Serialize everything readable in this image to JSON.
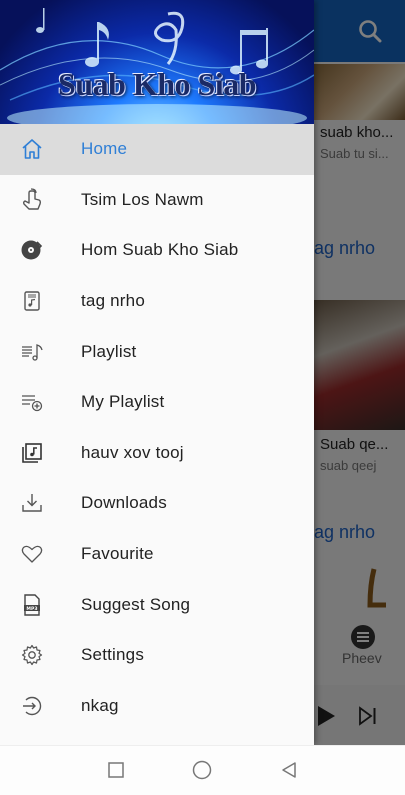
{
  "banner": {
    "title": "Suab Kho Siab"
  },
  "menu": [
    {
      "label": "Home",
      "icon": "home-icon",
      "active": true
    },
    {
      "label": "Tsim Los Nawm",
      "icon": "hand-pointer-icon",
      "active": false
    },
    {
      "label": "Hom Suab Kho Siab",
      "icon": "vinyl-disc-icon",
      "active": false
    },
    {
      "label": "tag nrho",
      "icon": "music-file-icon",
      "active": false
    },
    {
      "label": "Playlist",
      "icon": "playlist-icon",
      "active": false
    },
    {
      "label": "My Playlist",
      "icon": "playlist-add-icon",
      "active": false
    },
    {
      "label": "hauv xov tooj",
      "icon": "music-library-icon",
      "active": false
    },
    {
      "label": "Downloads",
      "icon": "download-icon",
      "active": false
    },
    {
      "label": "Favourite",
      "icon": "heart-icon",
      "active": false
    },
    {
      "label": "Suggest Song",
      "icon": "mp3-file-icon",
      "active": false
    },
    {
      "label": "Settings",
      "icon": "gear-icon",
      "active": false
    },
    {
      "label": "nkag",
      "icon": "login-icon",
      "active": false
    }
  ],
  "background": {
    "card1_title": "suab kho...",
    "card1_sub": "Suab tu si...",
    "section1": "ag nrho",
    "card2_title": "Suab qe...",
    "card2_sub": "suab qeej",
    "section2": "ag nrho",
    "nav_label": "Pheev"
  },
  "colors": {
    "accent": "#2f7fd6",
    "toolbar": "#1565c0",
    "active_bg": "#dcdcdc"
  }
}
